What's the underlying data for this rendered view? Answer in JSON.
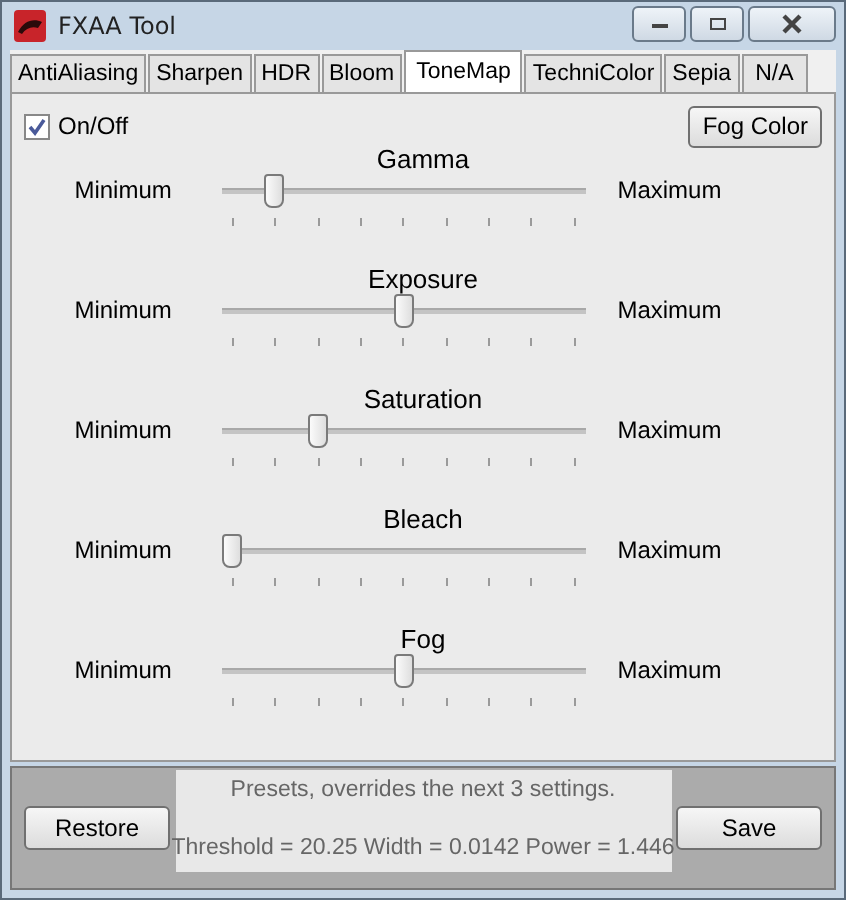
{
  "window": {
    "title": "FXAA Tool"
  },
  "tabs": [
    {
      "label": "AntiAliasing",
      "selected": false
    },
    {
      "label": "Sharpen",
      "selected": false
    },
    {
      "label": "HDR",
      "selected": false
    },
    {
      "label": "Bloom",
      "selected": false
    },
    {
      "label": "ToneMap",
      "selected": true
    },
    {
      "label": "TechniColor",
      "selected": false
    },
    {
      "label": "Sepia",
      "selected": false
    },
    {
      "label": "N/A",
      "selected": false
    }
  ],
  "on_off": {
    "label": "On/Off",
    "checked": true
  },
  "fog_color_button": "Fog Color",
  "sliders": [
    {
      "name": "Gamma",
      "min_label": "Minimum",
      "max_label": "Maximum",
      "level": 0.125
    },
    {
      "name": "Exposure",
      "min_label": "Minimum",
      "max_label": "Maximum",
      "level": 0.5
    },
    {
      "name": "Saturation",
      "min_label": "Minimum",
      "max_label": "Maximum",
      "level": 0.25
    },
    {
      "name": "Bleach",
      "min_label": "Minimum",
      "max_label": "Maximum",
      "level": 0
    },
    {
      "name": "Fog",
      "min_label": "Minimum",
      "max_label": "Maximum",
      "level": 0.5
    }
  ],
  "footer": {
    "restore_button": "Restore",
    "presets_note": "Presets, overrides the next 3 settings.",
    "presets_values": "Threshold = 20.25 Width = 0.0142 Power = 1.446",
    "save_button": "Save"
  }
}
